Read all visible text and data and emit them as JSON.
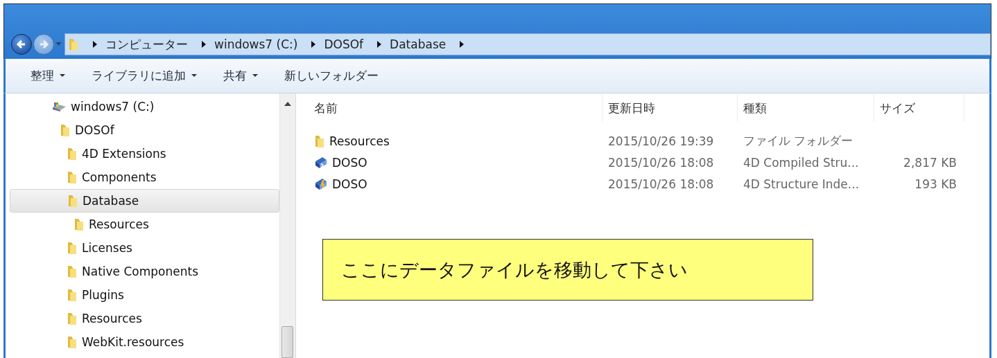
{
  "address_bar": {
    "crumbs": [
      "コンピューター",
      "windows7 (C:)",
      "DOSOf",
      "Database"
    ]
  },
  "toolbar": [
    {
      "label": "整理",
      "dropdown": true
    },
    {
      "label": "ライブラリに追加",
      "dropdown": true
    },
    {
      "label": "共有",
      "dropdown": true
    },
    {
      "label": "新しいフォルダー",
      "dropdown": false
    }
  ],
  "tree": [
    {
      "label": "windows7 (C:)",
      "kind": "drive",
      "selected": false,
      "children": [
        {
          "label": "DOSOf",
          "kind": "folder",
          "selected": false,
          "children": [
            {
              "label": "4D Extensions",
              "kind": "folder",
              "selected": false
            },
            {
              "label": "Components",
              "kind": "folder",
              "selected": false
            },
            {
              "label": "Database",
              "kind": "folder",
              "selected": true,
              "children": [
                {
                  "label": "Resources",
                  "kind": "folder",
                  "selected": false
                }
              ]
            },
            {
              "label": "Licenses",
              "kind": "folder",
              "selected": false
            },
            {
              "label": "Native Components",
              "kind": "folder",
              "selected": false
            },
            {
              "label": "Plugins",
              "kind": "folder",
              "selected": false
            },
            {
              "label": "Resources",
              "kind": "folder",
              "selected": false
            },
            {
              "label": "WebKit.resources",
              "kind": "folder",
              "selected": false
            }
          ]
        }
      ]
    }
  ],
  "columns": [
    "名前",
    "更新日時",
    "種類",
    "サイズ"
  ],
  "files": [
    {
      "name": "Resources",
      "kind": "folder",
      "modified": "2015/10/26 19:39",
      "type": "ファイル フォルダー"
    },
    {
      "name": "DOSO",
      "kind": "compiled",
      "modified": "2015/10/26 18:08",
      "type": "4D Compiled Stru...",
      "size": "2,817 KB"
    },
    {
      "name": "DOSO",
      "kind": "index",
      "modified": "2015/10/26 18:08",
      "type": "4D Structure Inde...",
      "size": "193 KB"
    }
  ],
  "callout": "ここにデータファイルを移動して下さい"
}
